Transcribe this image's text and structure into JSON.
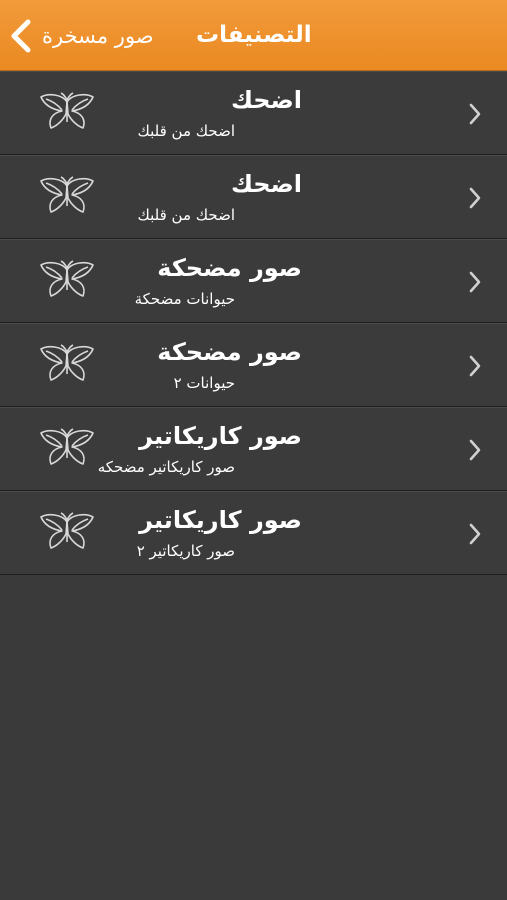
{
  "navbar": {
    "back_label": "صور مسخرة",
    "title": "التصنيفات",
    "accent_color": "#EE8F27"
  },
  "icons": {
    "back": "chevron-left-icon",
    "row": "butterfly-icon",
    "disclosure": "chevron-right-icon"
  },
  "rows": [
    {
      "title": "اضحك",
      "subtitle": "اضحك من قلبك"
    },
    {
      "title": "اضحك",
      "subtitle": "اضحك من قلبك"
    },
    {
      "title": "صور مضحكة",
      "subtitle": "حيوانات مضحكة"
    },
    {
      "title": "صور مضحكة",
      "subtitle": "حيوانات ٢"
    },
    {
      "title": "صور كاريكاتير",
      "subtitle": "صور كاريكاتير مضحكه"
    },
    {
      "title": "صور كاريكاتير",
      "subtitle": "صور كاريكاتير ٢"
    }
  ]
}
